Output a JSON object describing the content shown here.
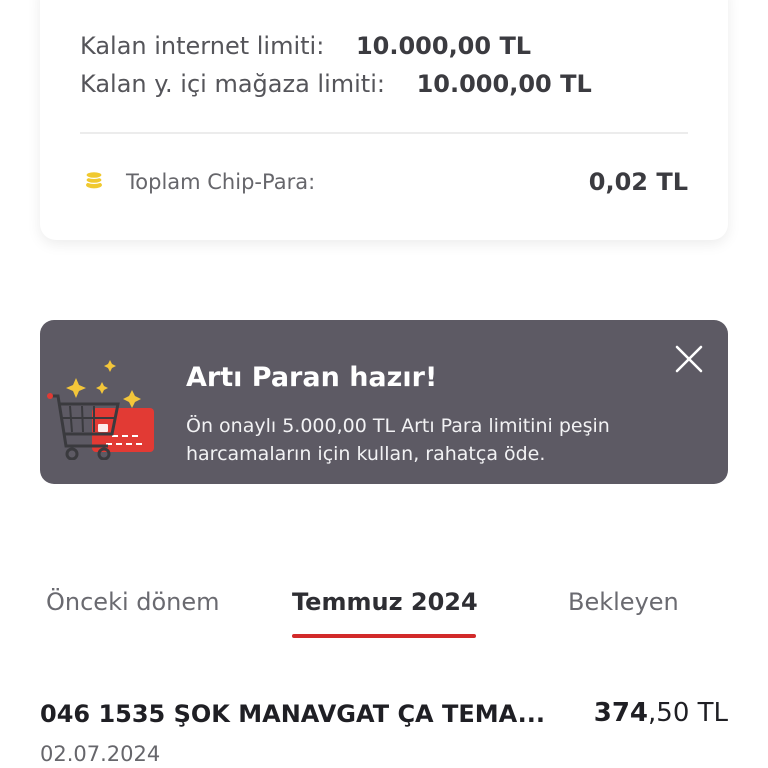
{
  "limits": {
    "internet_label": "Kalan internet limiti:",
    "internet_value": "10.000,00 TL",
    "store_label": "Kalan y. içi mağaza limiti:",
    "store_value": "10.000,00 TL",
    "chip_label": "Toplam Chip-Para:",
    "chip_value": "0,02 TL"
  },
  "promo": {
    "title": "Artı Paran hazır!",
    "text": "Ön onaylı 5.000,00 TL Artı Para limitini peşin harcamaların için kullan, rahatça öde."
  },
  "tabs": [
    {
      "label": "Önceki dönem",
      "active": false
    },
    {
      "label": "Temmuz 2024",
      "active": true
    },
    {
      "label": "Bekleyen",
      "active": false
    }
  ],
  "transactions": [
    {
      "merchant": "046 1535 ŞOK MANAVGAT ÇA TEMA...",
      "amount_int": "374",
      "amount_dec": ",50 TL",
      "date": "02.07.2024"
    }
  ],
  "icons": {
    "chip": "coin-stack-icon",
    "close": "close-icon",
    "promo": "shopping-cart-card-icon"
  },
  "colors": {
    "accent": "#d22a2a",
    "promo_bg": "#5d5a64",
    "coin": "#f0c930"
  }
}
